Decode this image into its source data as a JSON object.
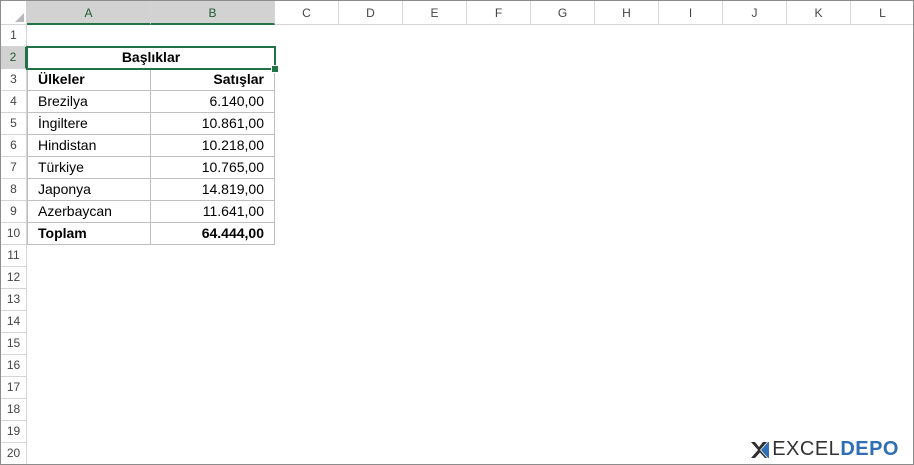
{
  "columns": [
    "A",
    "B",
    "C",
    "D",
    "E",
    "F",
    "G",
    "H",
    "I",
    "J",
    "K",
    "L"
  ],
  "selected_columns": [
    "A",
    "B"
  ],
  "rows": [
    "1",
    "2",
    "3",
    "4",
    "5",
    "6",
    "7",
    "8",
    "9",
    "10",
    "11",
    "12",
    "13",
    "14",
    "15",
    "16",
    "17",
    "18",
    "19",
    "20"
  ],
  "selected_rows": [
    "2"
  ],
  "table": {
    "merged_title": "Başlıklar",
    "header": [
      "Ülkeler",
      "Satışlar"
    ],
    "rows": [
      [
        "Brezilya",
        "6.140,00"
      ],
      [
        "İngiltere",
        "10.861,00"
      ],
      [
        "Hindistan",
        "10.218,00"
      ],
      [
        "Türkiye",
        "10.765,00"
      ],
      [
        "Japonya",
        "14.819,00"
      ],
      [
        "Azerbaycan",
        "11.641,00"
      ]
    ],
    "total": [
      "Toplam",
      "64.444,00"
    ]
  },
  "logo": {
    "part1": "EXCEL",
    "part2": "DEPO"
  },
  "colors": {
    "selection": "#217346",
    "header_selected_bg": "#d2d2d2",
    "logo_blue": "#2f6fb5"
  }
}
